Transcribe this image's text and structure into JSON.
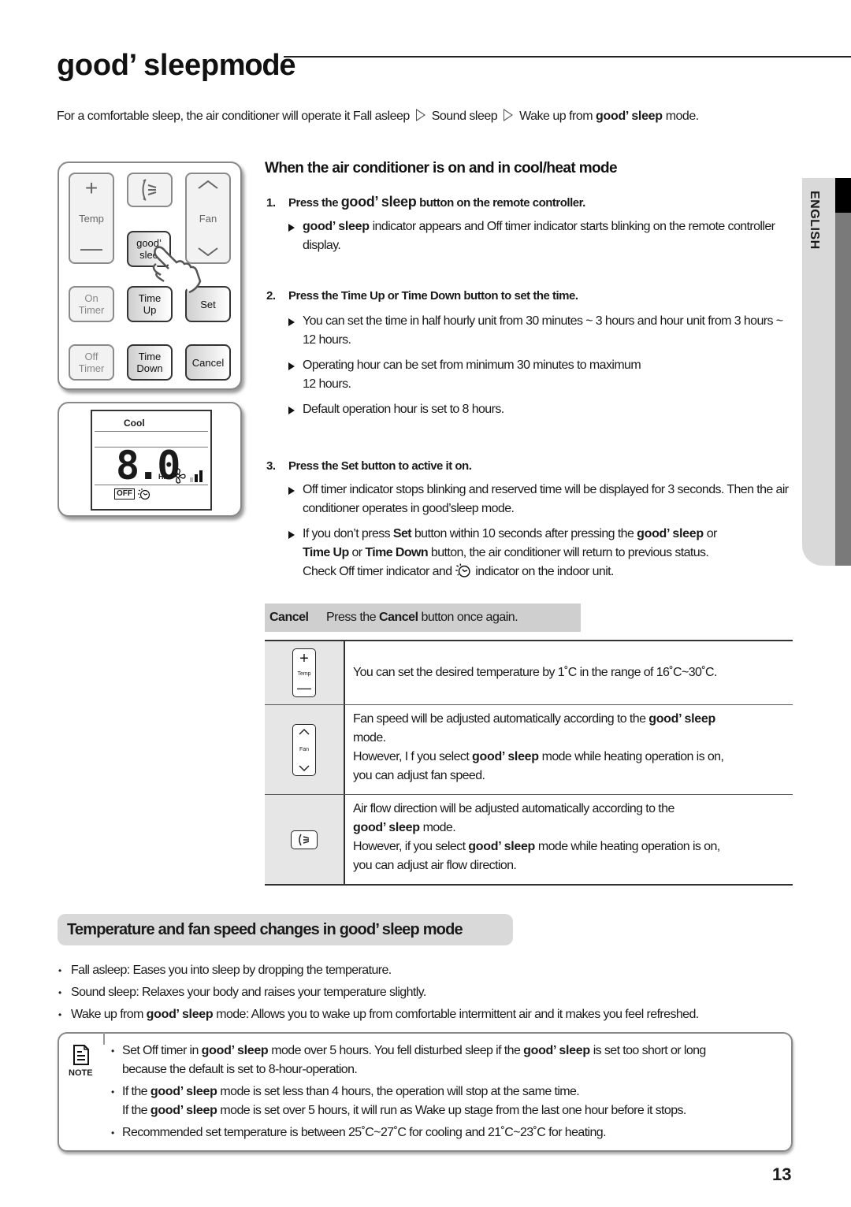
{
  "title": {
    "brand": "good’ sleep",
    "suffix": "mode"
  },
  "intro": {
    "lead": "For a comfortable sleep, the air conditioner will operate it Fall asleep",
    "stage2": "Sound sleep",
    "stage3_pre": "Wake up from",
    "brand": "good’ sleep",
    "end": "mode."
  },
  "side_tab": {
    "label": "ENGLISH"
  },
  "remote": {
    "buttons": {
      "temp_plus": "+",
      "temp_label": "Temp",
      "temp_minus": "—",
      "swing": "airflow",
      "fan_up": "︿",
      "fan_label": "Fan",
      "fan_down": "﹀",
      "good_sleep_1": "good’",
      "good_sleep_2": "slee",
      "on_timer_1": "On",
      "on_timer_2": "Timer",
      "time_up_1": "Time",
      "time_up_2": "Up",
      "set": "Set",
      "off_timer_1": "Off",
      "off_timer_2": "Timer",
      "time_down_1": "Time",
      "time_down_2": "Down",
      "cancel": "Cancel"
    },
    "display": {
      "mode": "Cool",
      "time": "8.0",
      "unit": "HR",
      "off": "OFF"
    }
  },
  "section1": {
    "heading": "When the air conditioner is on and in cool/heat mode",
    "steps": [
      {
        "num": "1.",
        "pre": "Press the",
        "brand": "good’ sleep",
        "post": "button on the remote controller.",
        "subs": [
          {
            "brand": "good’ sleep",
            "text": "indicator appears and Off timer indicator starts blinking on the remote controller display."
          }
        ]
      },
      {
        "num": "2.",
        "text": "Press the Time Up or Time Down button to set the time.",
        "subs": [
          {
            "text": "You can set the time in half hourly unit from 30 minutes ~ 3 hours and hour unit from 3 hours ~ 12 hours."
          },
          {
            "text_l1": "Operating hour can be set from minimum 30 minutes to maximum",
            "text_l2": "12 hours."
          },
          {
            "text": "Default operation hour is set to 8 hours."
          }
        ]
      },
      {
        "num": "3.",
        "text": "Press the Set button to active it on.",
        "subs": [
          {
            "text": "Off timer indicator stops blinking and reserved time will be displayed for 3 seconds. Then the air conditioner operates in good’sleep mode."
          },
          {
            "p1": "If you don’t press",
            "b1": "Set",
            "p2": "button within 10 seconds after pressing the",
            "brand": "good’ sleep",
            "p3": "or",
            "b2": "Time Up",
            "p4": "or",
            "b3": "Time Down",
            "p5": "button, the air conditioner will return to previous status.",
            "p6": "Check Off timer indicator and",
            "p7": "indicator on the indoor unit."
          }
        ]
      }
    ],
    "cancel": {
      "key": "Cancel",
      "pre": "Press the",
      "bold": "Cancel",
      "post": "button once again."
    }
  },
  "table": {
    "rows": [
      {
        "icon": "temp-button-icon",
        "icon_label": "Temp",
        "text": "You can set the desired temperature by 1˚C in the range of 16˚C~30˚C."
      },
      {
        "icon": "fan-button-icon",
        "icon_label": "Fan",
        "l1_pre": "Fan speed will be adjusted automatically according to the",
        "l1_brand": "good’ sleep",
        "l2": "mode.",
        "l3_pre": "However, I f you select",
        "l3_brand": "good’ sleep",
        "l3_post": "mode while heating operation is on,",
        "l4": "you can adjust fan speed."
      },
      {
        "icon": "airflow-button-icon",
        "l1": "Air flow direction will be adjusted automatically according to the",
        "l2_brand": "good’ sleep",
        "l2_post": "mode.",
        "l3_pre": "However, if you select",
        "l3_brand": "good’ sleep",
        "l3_post": "mode while heating operation is on,",
        "l4": "you can adjust air flow direction."
      }
    ]
  },
  "section2": {
    "heading_pre": "Temperature and fan speed changes in",
    "heading_brand": "good’ sleep",
    "heading_post": "mode",
    "bullets": [
      {
        "text": "Fall asleep: Eases you into sleep by dropping the temperature."
      },
      {
        "text": "Sound sleep: Relaxes your body and raises your temperature slightly."
      },
      {
        "pre": "Wake up from",
        "brand": "good’ sleep",
        "post": "mode: Allows you to wake up from comfortable intermittent air and it makes you feel refreshed."
      }
    ]
  },
  "note": {
    "label": "NOTE",
    "items": [
      {
        "p1": "Set Off timer in",
        "b1": "good’ sleep",
        "p2": "mode over 5 hours. You fell disturbed sleep if the",
        "b2": "good’ sleep",
        "p3": "is set too short or long",
        "p4": "because the default is set to 8-hour-operation."
      },
      {
        "p1": "If the",
        "b1": "good’ sleep",
        "p2": "mode is set less than 4 hours, the operation will stop at the same time.",
        "p3": "If the",
        "b2": "good’ sleep",
        "p4": "mode is set over 5 hours, it will run as Wake up stage from the last one hour before it stops."
      },
      {
        "text": "Recommended set temperature is between 25˚C~27˚C for cooling and 21˚C~23˚C for heating."
      }
    ]
  },
  "page_number": "13"
}
